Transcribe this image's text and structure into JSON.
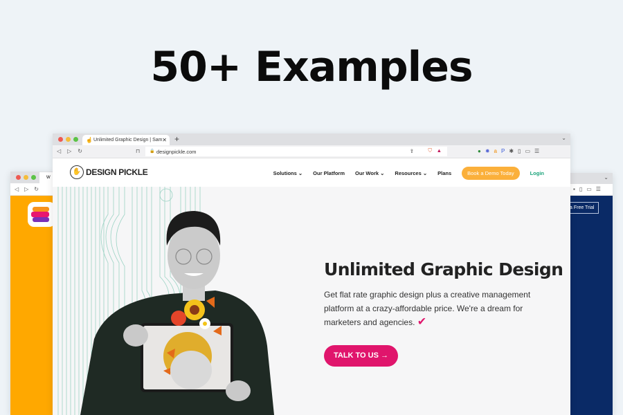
{
  "headline": "50+ Examples",
  "back_left": {
    "tab_initial": "W",
    "logo_bg": "#ffa800"
  },
  "back_right": {
    "cta": "a Free Trial",
    "bg": "#0a2a66"
  },
  "browser": {
    "tab_title": "Unlimited Graphic Design | Sam",
    "new_tab": "+",
    "url": "designpickle.com",
    "chevron": "⌄"
  },
  "site": {
    "logo": "DESIGN PICKLE",
    "nav": [
      {
        "label": "Solutions ⌄"
      },
      {
        "label": "Our Platform"
      },
      {
        "label": "Our Work ⌄"
      },
      {
        "label": "Resources ⌄"
      },
      {
        "label": "Plans"
      }
    ],
    "demo_button": "Book a Demo Today",
    "login": "Login",
    "hero": {
      "title": "Unlimited Graphic Design",
      "description": "Get flat rate graphic design plus a creative management platform at a crazy-affordable price. We're a dream for marketers and agencies.",
      "cta": "TALK TO US →"
    },
    "colors": {
      "accent": "#e0156c",
      "demo": "#fbb03b",
      "login": "#1aa37a"
    }
  }
}
